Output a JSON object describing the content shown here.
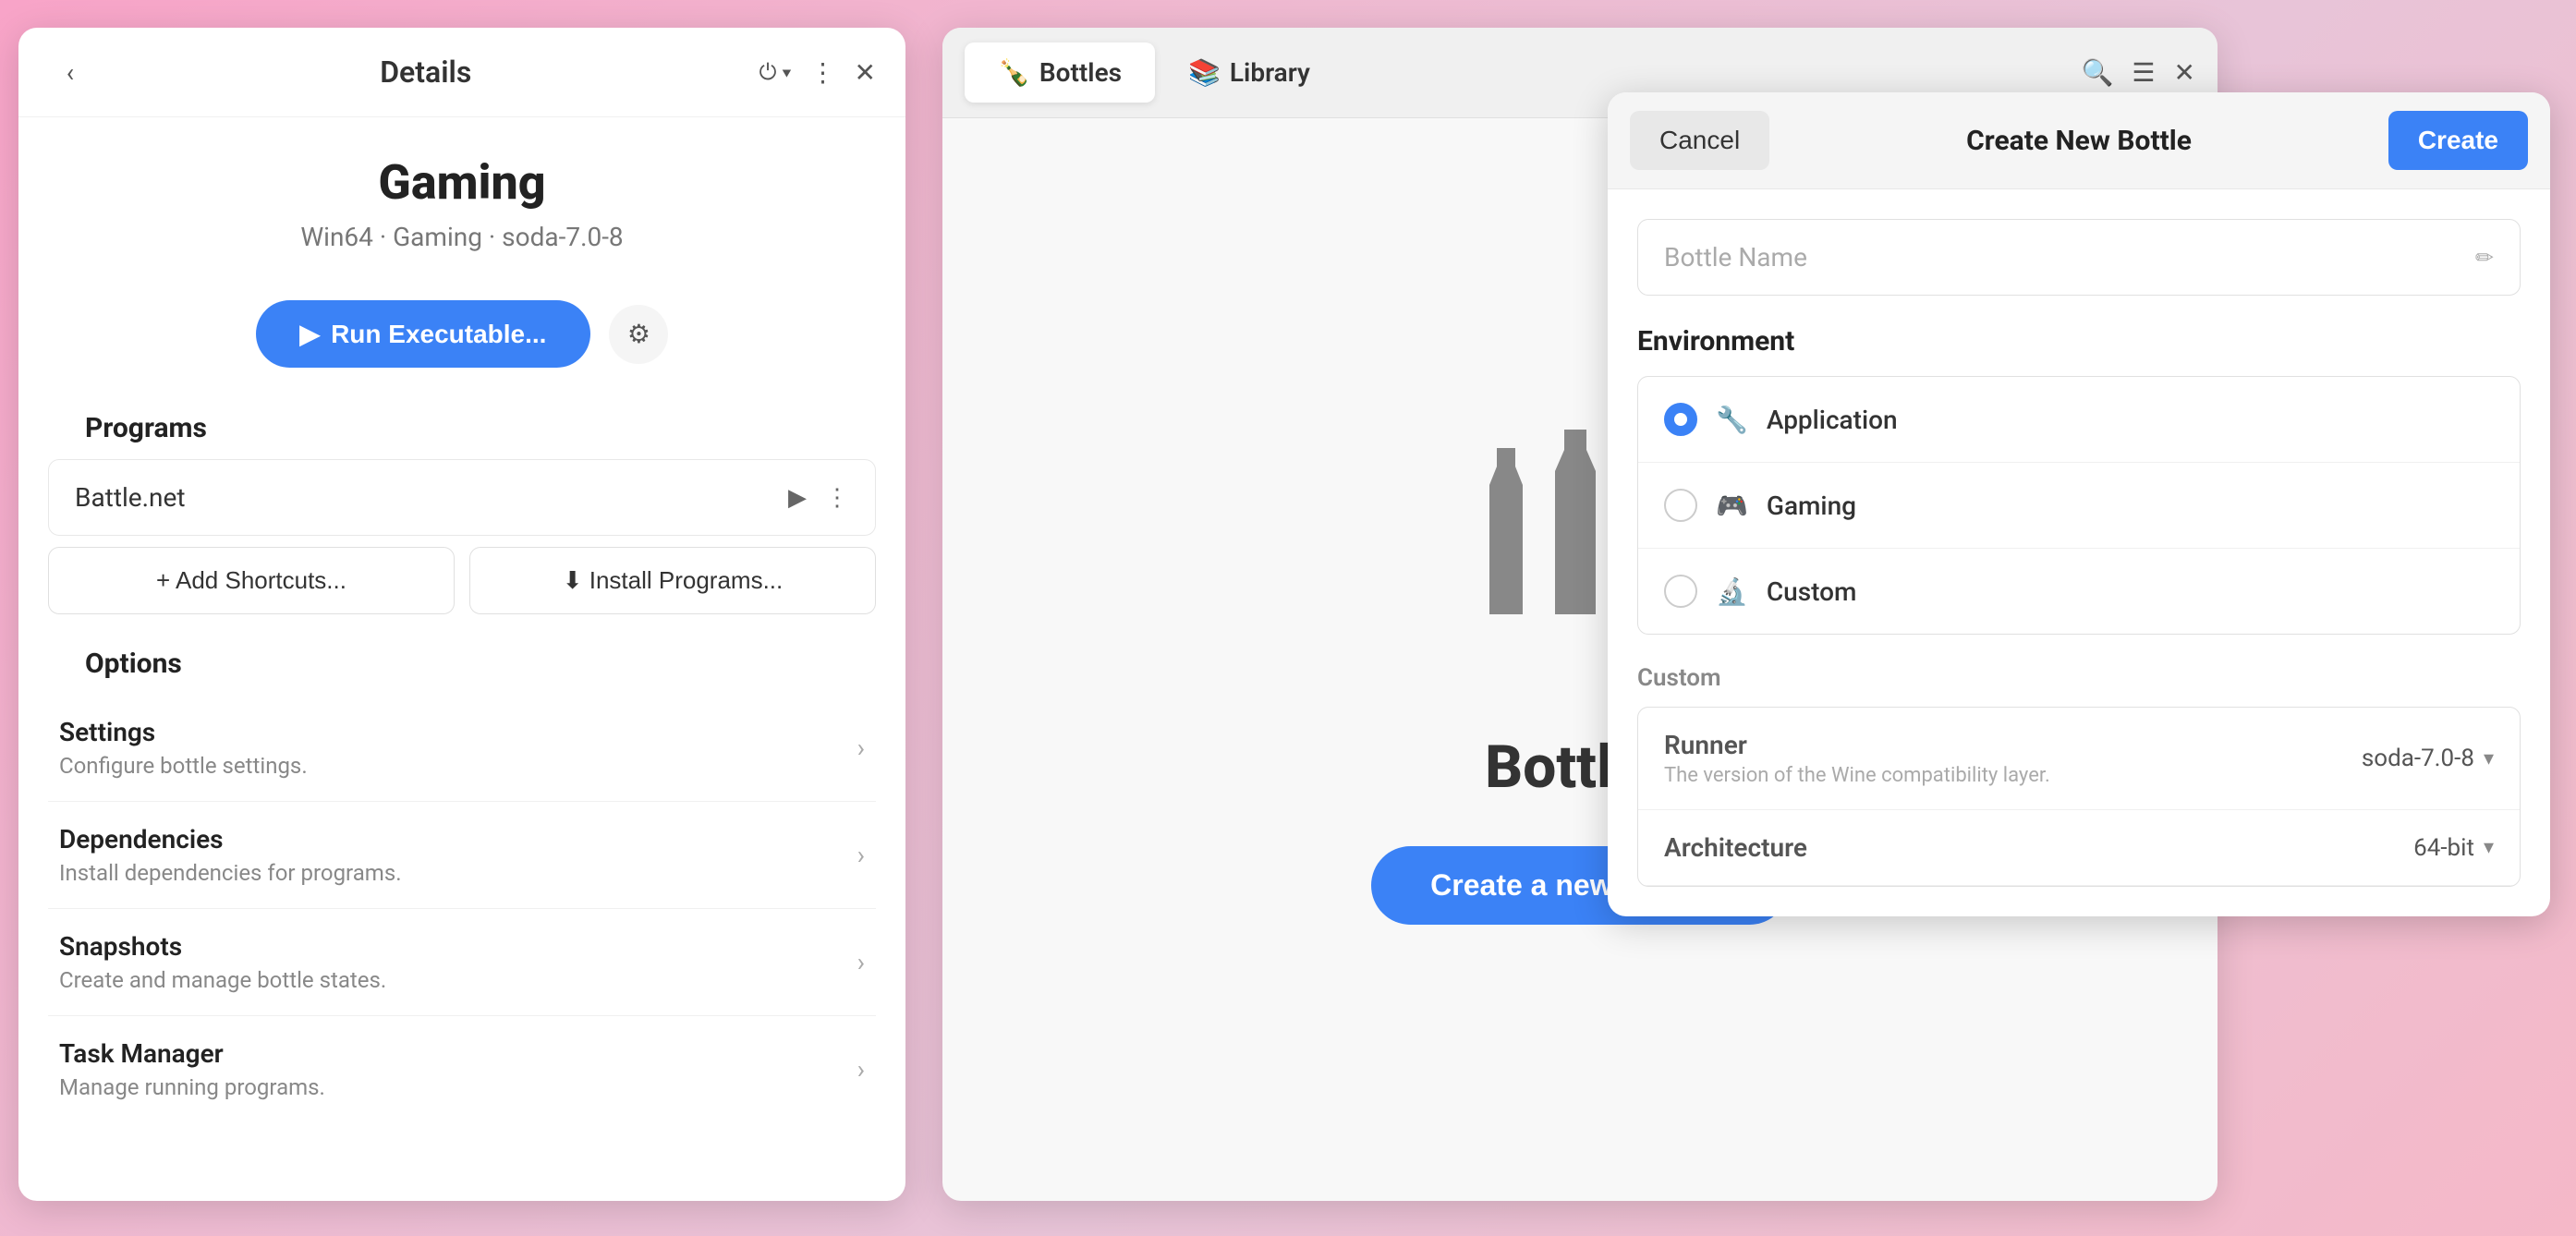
{
  "background": {
    "gradient": "linear-gradient(135deg, #f8a4c8, #f0b8d0, #e8c4d8, #f5b8c8)"
  },
  "details_panel": {
    "title": "Details",
    "app_name": "Gaming",
    "app_subtitle": "Win64 · Gaming · soda-7.0-8",
    "run_button": "Run Executable...",
    "sections": {
      "programs_title": "Programs",
      "options_title": "Options"
    },
    "programs": [
      {
        "name": "Battle.net"
      }
    ],
    "shortcuts_btn": "+ Add Shortcuts...",
    "install_btn": "⬇ Install Programs...",
    "options": [
      {
        "label": "Settings",
        "desc": "Configure bottle settings."
      },
      {
        "label": "Dependencies",
        "desc": "Install dependencies for programs."
      },
      {
        "label": "Snapshots",
        "desc": "Create and manage bottle states."
      },
      {
        "label": "Task Manager",
        "desc": "Manage running programs."
      }
    ]
  },
  "bottles_panel": {
    "tabs": [
      {
        "label": "Bottles",
        "active": true
      },
      {
        "label": "Library",
        "active": false
      }
    ],
    "bottles_label": "Bottles",
    "create_button": "Create a new Bottle..."
  },
  "create_panel": {
    "title": "Create New Bottle",
    "cancel_btn": "Cancel",
    "create_btn": "Create",
    "bottle_name_placeholder": "Bottle Name",
    "environment_title": "Environment",
    "environments": [
      {
        "label": "Application",
        "selected": true,
        "icon": "🔧"
      },
      {
        "label": "Gaming",
        "selected": false,
        "icon": "🎮"
      },
      {
        "label": "Custom",
        "selected": false,
        "icon": "🔬"
      }
    ],
    "custom_title": "Custom",
    "runner_label": "Runner",
    "runner_desc": "The version of the Wine compatibility layer.",
    "runner_value": "soda-7.0-8",
    "architecture_label": "Architecture",
    "architecture_value": "64-bit"
  }
}
